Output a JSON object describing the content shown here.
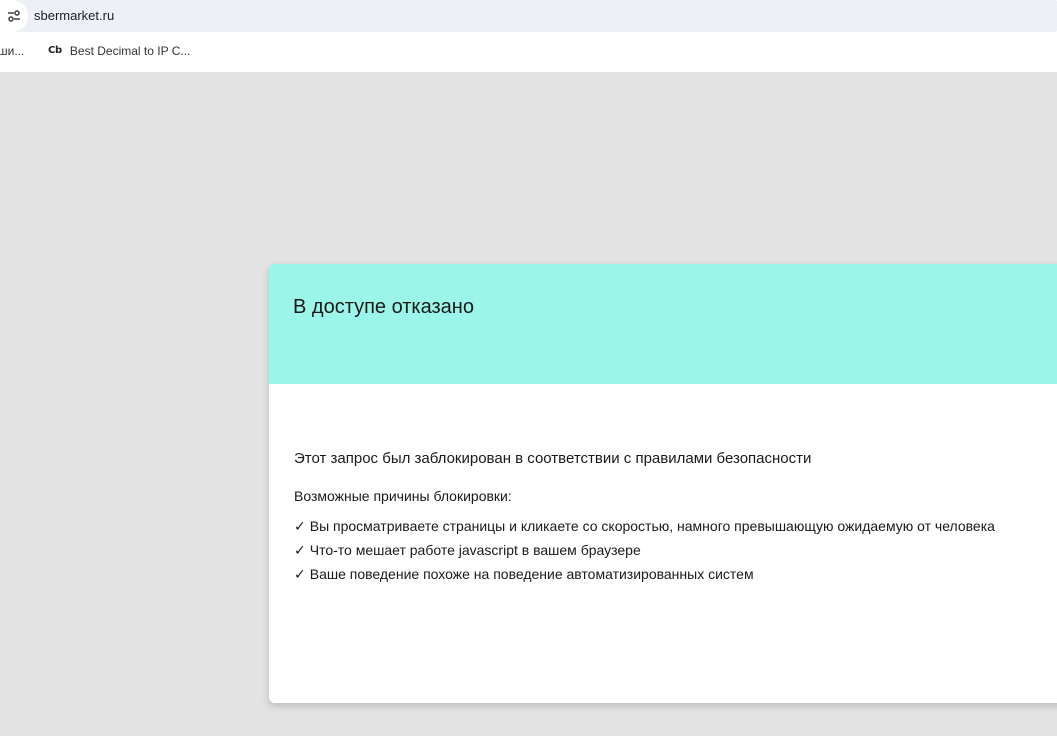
{
  "browser": {
    "url": "sbermarket.ru",
    "site_info_icon": "tune-icon",
    "bookmarks": [
      {
        "label": "ши..."
      },
      {
        "favicon_text": "Cb",
        "label": "Best Decimal to IP C..."
      }
    ]
  },
  "page": {
    "title": "В доступе отказано",
    "lead": "Этот запрос был заблокирован в соответствии с правилами безопасности",
    "reasons_title": "Возможные причины блокировки:",
    "check_mark": "✓",
    "reasons": [
      "Вы просматриваете страницы и кликаете со скоростью, намного превышающую ожидаемую от человека",
      "Что-то мешает работе javascript в вашем браузере",
      "Ваше поведение похоже на поведение автоматизированных систем"
    ],
    "colors": {
      "header_bg": "#9bf5e8",
      "page_bg": "#e3e3e3",
      "card_bg": "#ffffff"
    }
  }
}
